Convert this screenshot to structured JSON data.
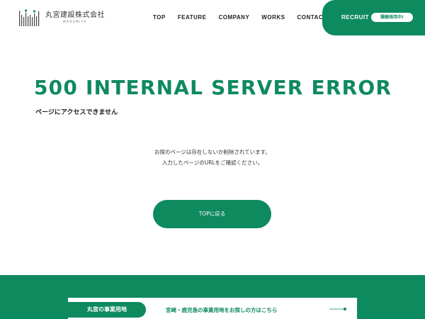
{
  "header": {
    "logo_name": "丸宮建設株式会社",
    "logo_sub": "MARUMIYA",
    "nav": [
      "TOP",
      "FEATURE",
      "COMPANY",
      "WORKS",
      "CONTACT"
    ],
    "recruit_label": "RECRUIT",
    "recruit_badge": "積極採用中!"
  },
  "error": {
    "title": "500 INTERNAL SERVER ERROR",
    "subtitle": "ページにアクセスできません",
    "message_line1": "お探のページは存在しないか削除されています。",
    "message_line2": "入力したページのURLをご確認ください。",
    "top_button": "TOPに戻る"
  },
  "footer": {
    "land_tab": "丸宮の事業用地",
    "land_link": "宮崎・鹿児島の事業用地をお探しの方はこちら"
  },
  "colors": {
    "brand_green": "#0e8a5f",
    "text_dark": "#222222"
  },
  "icons": [
    "logo-mark-icon",
    "arrow-right-icon"
  ]
}
